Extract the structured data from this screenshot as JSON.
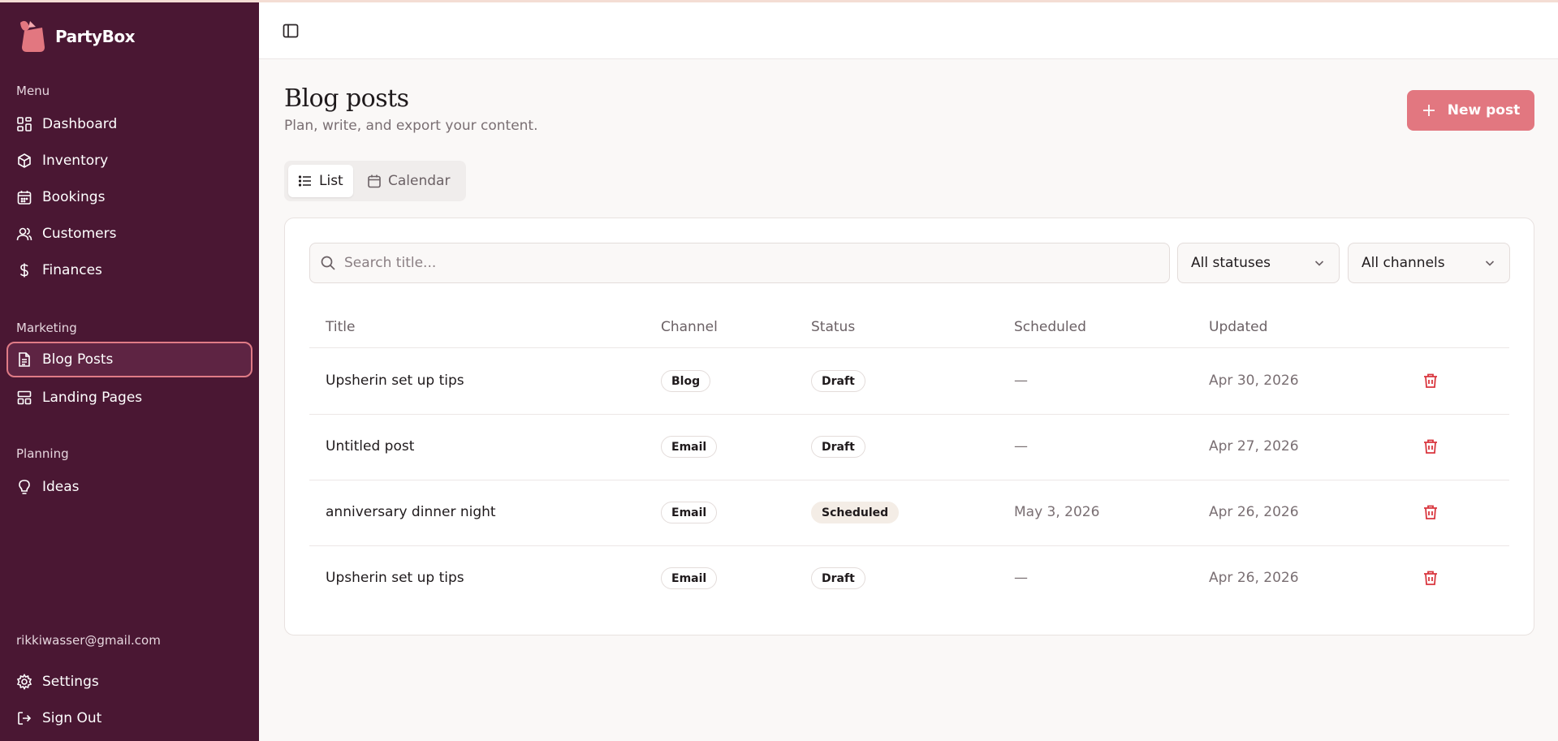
{
  "app": {
    "name": "PartyBox"
  },
  "sidebar": {
    "menu_label": "Menu",
    "menu_items": [
      {
        "label": "Dashboard",
        "icon": "dashboard-icon"
      },
      {
        "label": "Inventory",
        "icon": "package-icon"
      },
      {
        "label": "Bookings",
        "icon": "calendar-icon"
      },
      {
        "label": "Customers",
        "icon": "users-icon"
      },
      {
        "label": "Finances",
        "icon": "dollar-icon"
      }
    ],
    "marketing_label": "Marketing",
    "marketing_items": [
      {
        "label": "Blog Posts",
        "icon": "file-text-icon",
        "active": true
      },
      {
        "label": "Landing Pages",
        "icon": "layout-icon"
      }
    ],
    "planning_label": "Planning",
    "planning_items": [
      {
        "label": "Ideas",
        "icon": "lightbulb-icon"
      }
    ],
    "user_email": "rikkiwasser@gmail.com",
    "settings_label": "Settings",
    "signout_label": "Sign Out"
  },
  "header": {
    "title": "Blog posts",
    "subtitle": "Plan, write, and export your content.",
    "new_post_label": "New post"
  },
  "view_toggle": {
    "list_label": "List",
    "calendar_label": "Calendar",
    "selected": "List"
  },
  "filters": {
    "search_placeholder": "Search title...",
    "status_value": "All statuses",
    "channel_value": "All channels"
  },
  "table": {
    "columns": [
      "Title",
      "Channel",
      "Status",
      "Scheduled",
      "Updated"
    ],
    "rows": [
      {
        "title": "Upsherin set up tips",
        "channel": "Blog",
        "status": "Draft",
        "scheduled": "—",
        "updated": "Apr 30, 2026"
      },
      {
        "title": "Untitled post",
        "channel": "Email",
        "status": "Draft",
        "scheduled": "—",
        "updated": "Apr 27, 2026"
      },
      {
        "title": "anniversary dinner night",
        "channel": "Email",
        "status": "Scheduled",
        "scheduled": "May 3, 2026",
        "updated": "Apr 26, 2026"
      },
      {
        "title": "Upsherin set up tips",
        "channel": "Email",
        "status": "Draft",
        "scheduled": "—",
        "updated": "Apr 26, 2026"
      }
    ]
  },
  "colors": {
    "sidebar_bg": "#4a1733",
    "accent": "#e27780",
    "delete": "#d9363e"
  }
}
